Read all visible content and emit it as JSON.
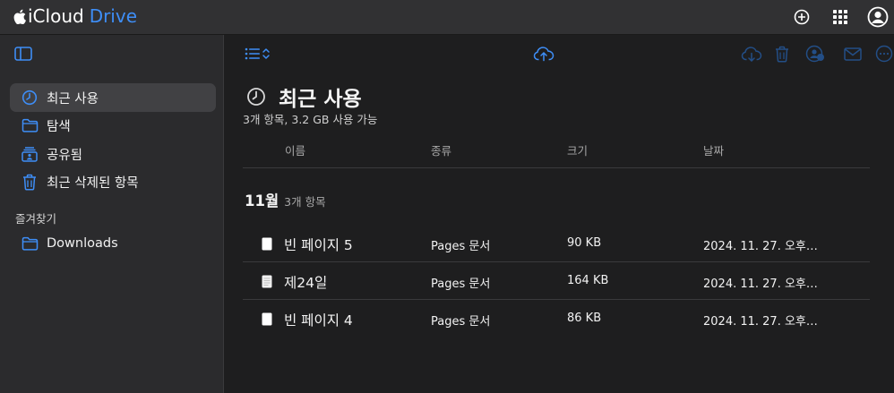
{
  "app": {
    "brand_word1": "iCloud",
    "brand_word2": "Drive",
    "accent": "#3e8ef7"
  },
  "topbar": {
    "icons": [
      "add-circle-icon",
      "app-grid-icon",
      "account-icon"
    ]
  },
  "sidebar": {
    "items": [
      {
        "label": "최근 사용",
        "icon": "clock-icon",
        "active": true
      },
      {
        "label": "탐색",
        "icon": "folder-icon",
        "active": false
      },
      {
        "label": "공유됨",
        "icon": "shared-folder-icon",
        "active": false
      },
      {
        "label": "최근 삭제된 항목",
        "icon": "trash-icon",
        "active": false
      }
    ],
    "favorites_heading": "즐겨찾기",
    "favorites": [
      {
        "label": "Downloads",
        "icon": "folder-icon"
      }
    ]
  },
  "toolbar": {
    "icons": [
      "list-view-icon",
      "sort-chevrons-icon",
      "upload-icon",
      "download-icon",
      "delete-icon",
      "share-people-icon",
      "mail-icon",
      "more-icon"
    ]
  },
  "main": {
    "title": "최근 사용",
    "subtitle": "3개 항목, 3.2 GB 사용 가능",
    "columns": {
      "name": "이름",
      "kind": "종류",
      "size": "크기",
      "date": "날짜"
    },
    "group": {
      "month": "11월",
      "count": "3개 항목"
    },
    "files": [
      {
        "name": "빈 페이지 5",
        "kind": "Pages 문서",
        "size": "90 KB",
        "date": "2024. 11. 27. 오후…"
      },
      {
        "name": "제24일",
        "kind": "Pages 문서",
        "size": "164 KB",
        "date": "2024. 11. 27. 오후…"
      },
      {
        "name": "빈 페이지 4",
        "kind": "Pages 문서",
        "size": "86 KB",
        "date": "2024. 11. 27. 오후…"
      }
    ]
  }
}
